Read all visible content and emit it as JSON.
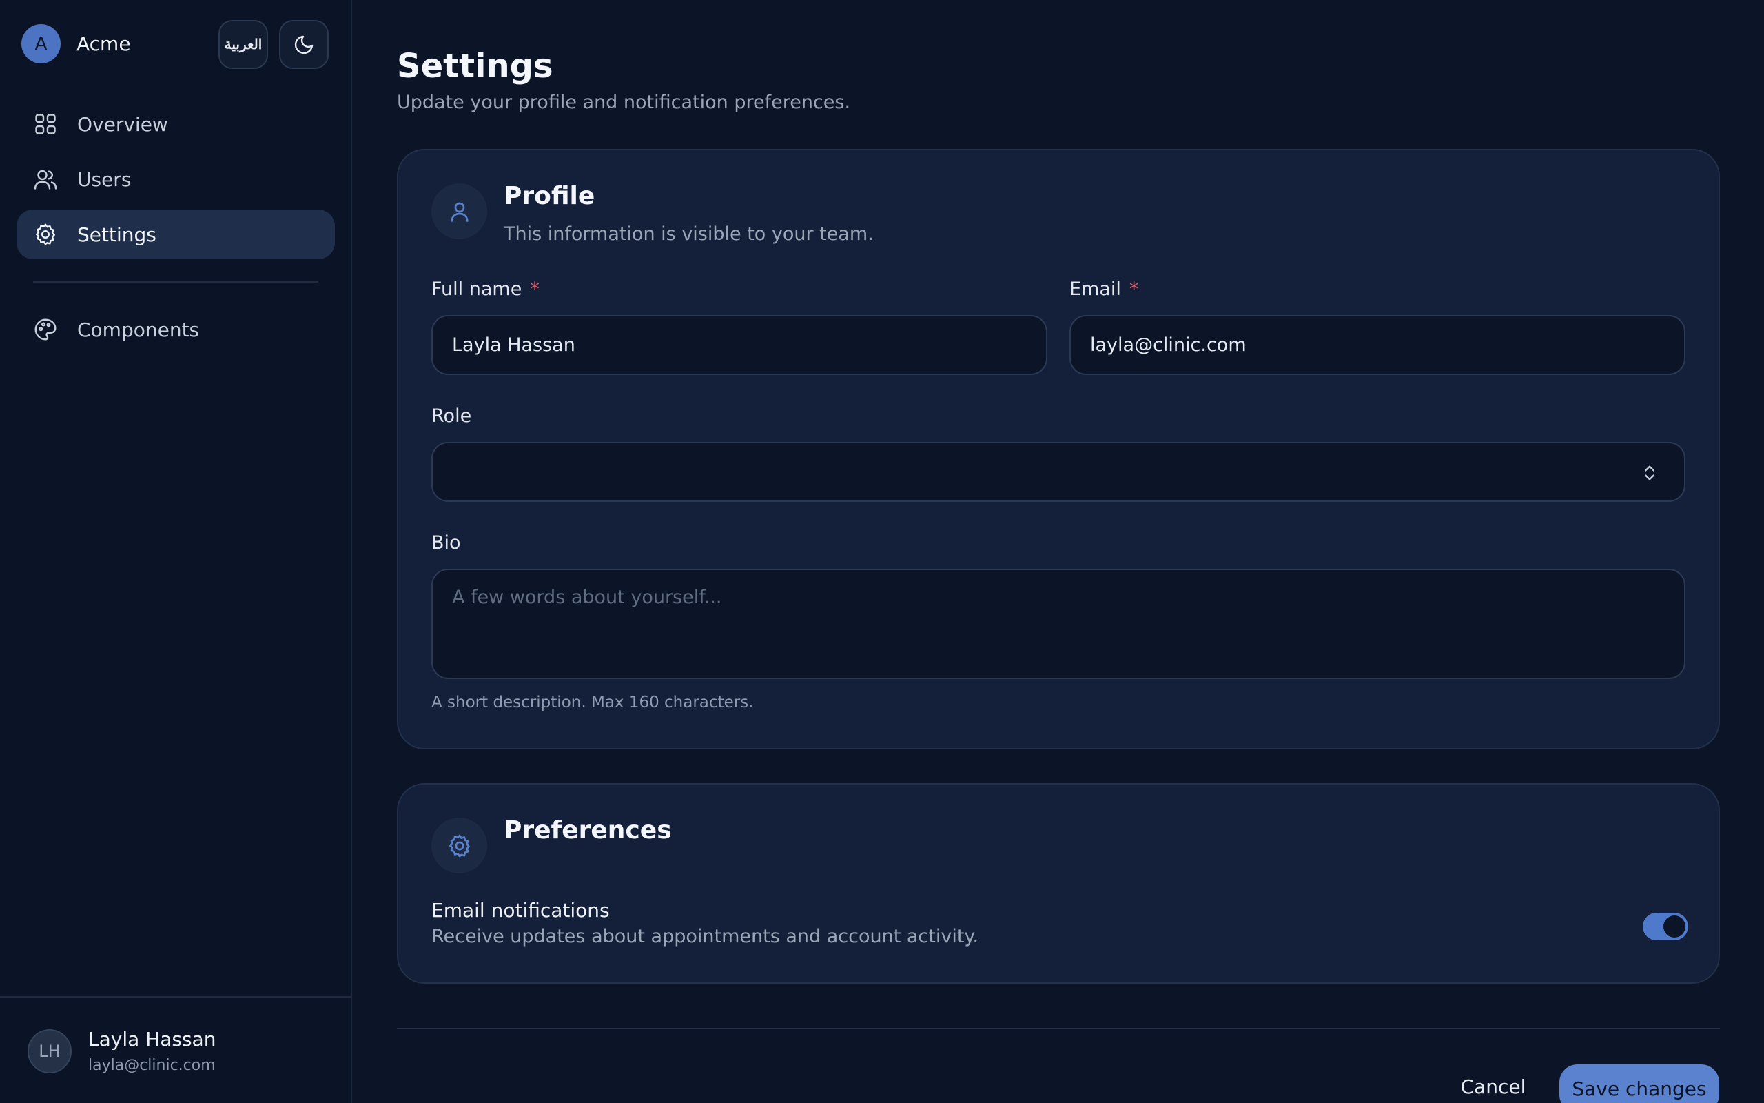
{
  "app": {
    "brand_initial": "A",
    "brand_name": "Acme",
    "language_toggle": "العربية"
  },
  "nav": [
    {
      "label": "Overview",
      "icon": "grid-icon"
    },
    {
      "label": "Users",
      "icon": "users-icon"
    },
    {
      "label": "Settings",
      "icon": "gear-icon",
      "active": true
    },
    {
      "label": "Components",
      "icon": "palette-icon"
    }
  ],
  "user": {
    "initials": "LH",
    "name": "Layla Hassan",
    "email": "layla@clinic.com"
  },
  "page": {
    "title": "Settings",
    "subtitle": "Update your profile and notification preferences."
  },
  "profile": {
    "title": "Profile",
    "description": "This information is visible to your team.",
    "full_name_label": "Full name",
    "full_name_value": "Layla Hassan",
    "email_label": "Email",
    "email_value": "layla@clinic.com",
    "required_marker": "*",
    "role_label": "Role",
    "role_value": "",
    "bio_label": "Bio",
    "bio_placeholder": "A few words about yourself...",
    "bio_help": "A short description. Max 160 characters."
  },
  "preferences": {
    "title": "Preferences",
    "email_notifications_label": "Email notifications",
    "email_notifications_desc": "Receive updates about appointments and account activity.",
    "email_notifications_on": true
  },
  "actions": {
    "cancel": "Cancel",
    "save": "Save changes"
  },
  "colors": {
    "accent": "#5a82cf",
    "background": "#0c1528",
    "card": "#142039",
    "required": "#e05d6a"
  }
}
